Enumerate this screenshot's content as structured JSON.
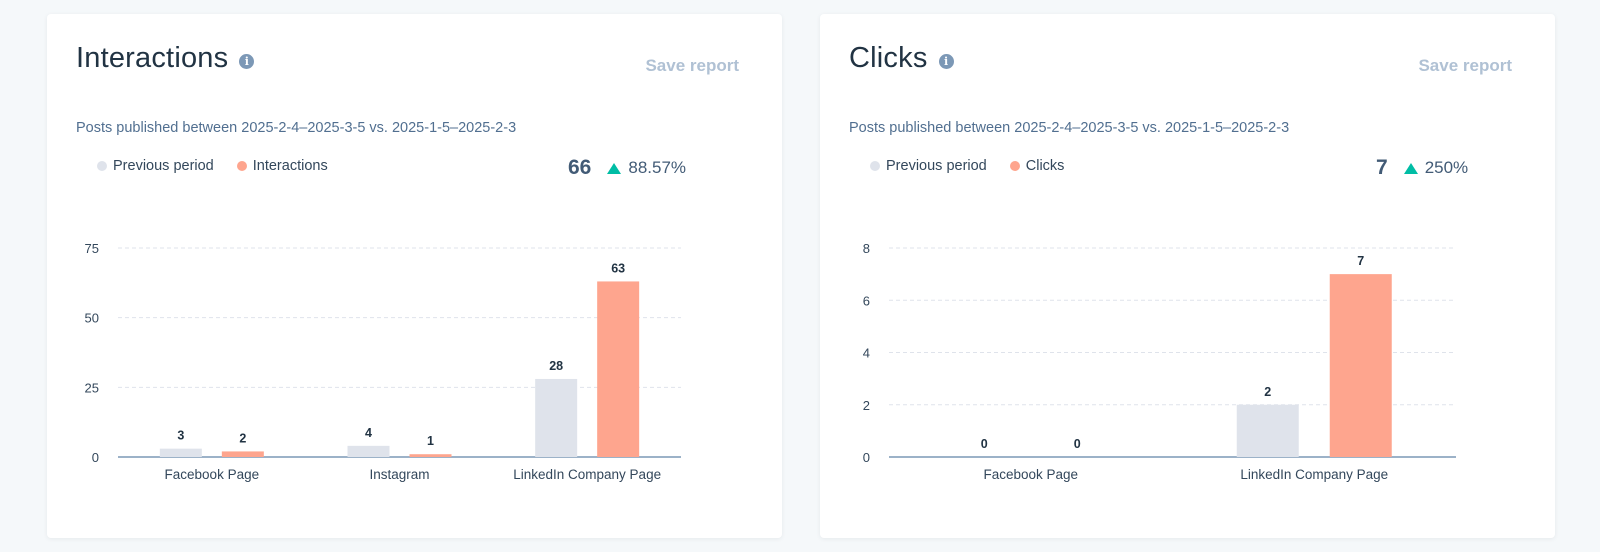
{
  "colors": {
    "previous": "#dfe3eb",
    "current": "#fea58e",
    "trend_up": "#00bda5",
    "axis": "#7c98b6",
    "grid": "#dfe3eb"
  },
  "cards": [
    {
      "title": "Interactions",
      "info_icon": "info-icon",
      "save_label": "Save report",
      "subtitle": "Posts published between 2025-2-4–2025-3-5 vs. 2025-1-5–2025-2-3",
      "legend": [
        {
          "label": "Previous period",
          "key": "previous"
        },
        {
          "label": "Interactions",
          "key": "current"
        }
      ],
      "summary": {
        "value": "66",
        "trend": "up",
        "change": "88.57%"
      }
    },
    {
      "title": "Clicks",
      "info_icon": "info-icon",
      "save_label": "Save report",
      "subtitle": "Posts published between 2025-2-4–2025-3-5 vs. 2025-1-5–2025-2-3",
      "legend": [
        {
          "label": "Previous period",
          "key": "previous"
        },
        {
          "label": "Clicks",
          "key": "current"
        }
      ],
      "summary": {
        "value": "7",
        "trend": "up",
        "change": "250%"
      }
    }
  ],
  "chart_data": [
    {
      "type": "bar",
      "title": "Interactions",
      "xlabel": "",
      "ylabel": "",
      "categories": [
        "Facebook Page",
        "Instagram",
        "LinkedIn Company Page"
      ],
      "series": [
        {
          "name": "Previous period",
          "values": [
            3,
            4,
            28
          ]
        },
        {
          "name": "Interactions",
          "values": [
            2,
            1,
            63
          ]
        }
      ],
      "ylim": [
        0,
        75
      ],
      "yticks": [
        0,
        25,
        50,
        75
      ],
      "grid": true,
      "legend": "top-left",
      "data_labels": true
    },
    {
      "type": "bar",
      "title": "Clicks",
      "xlabel": "",
      "ylabel": "",
      "categories": [
        "Facebook Page",
        "LinkedIn Company Page"
      ],
      "series": [
        {
          "name": "Previous period",
          "values": [
            0,
            2
          ]
        },
        {
          "name": "Clicks",
          "values": [
            0,
            7
          ]
        }
      ],
      "ylim": [
        0,
        8
      ],
      "yticks": [
        0,
        2,
        4,
        6,
        8
      ],
      "grid": true,
      "legend": "top-left",
      "data_labels": true
    }
  ]
}
